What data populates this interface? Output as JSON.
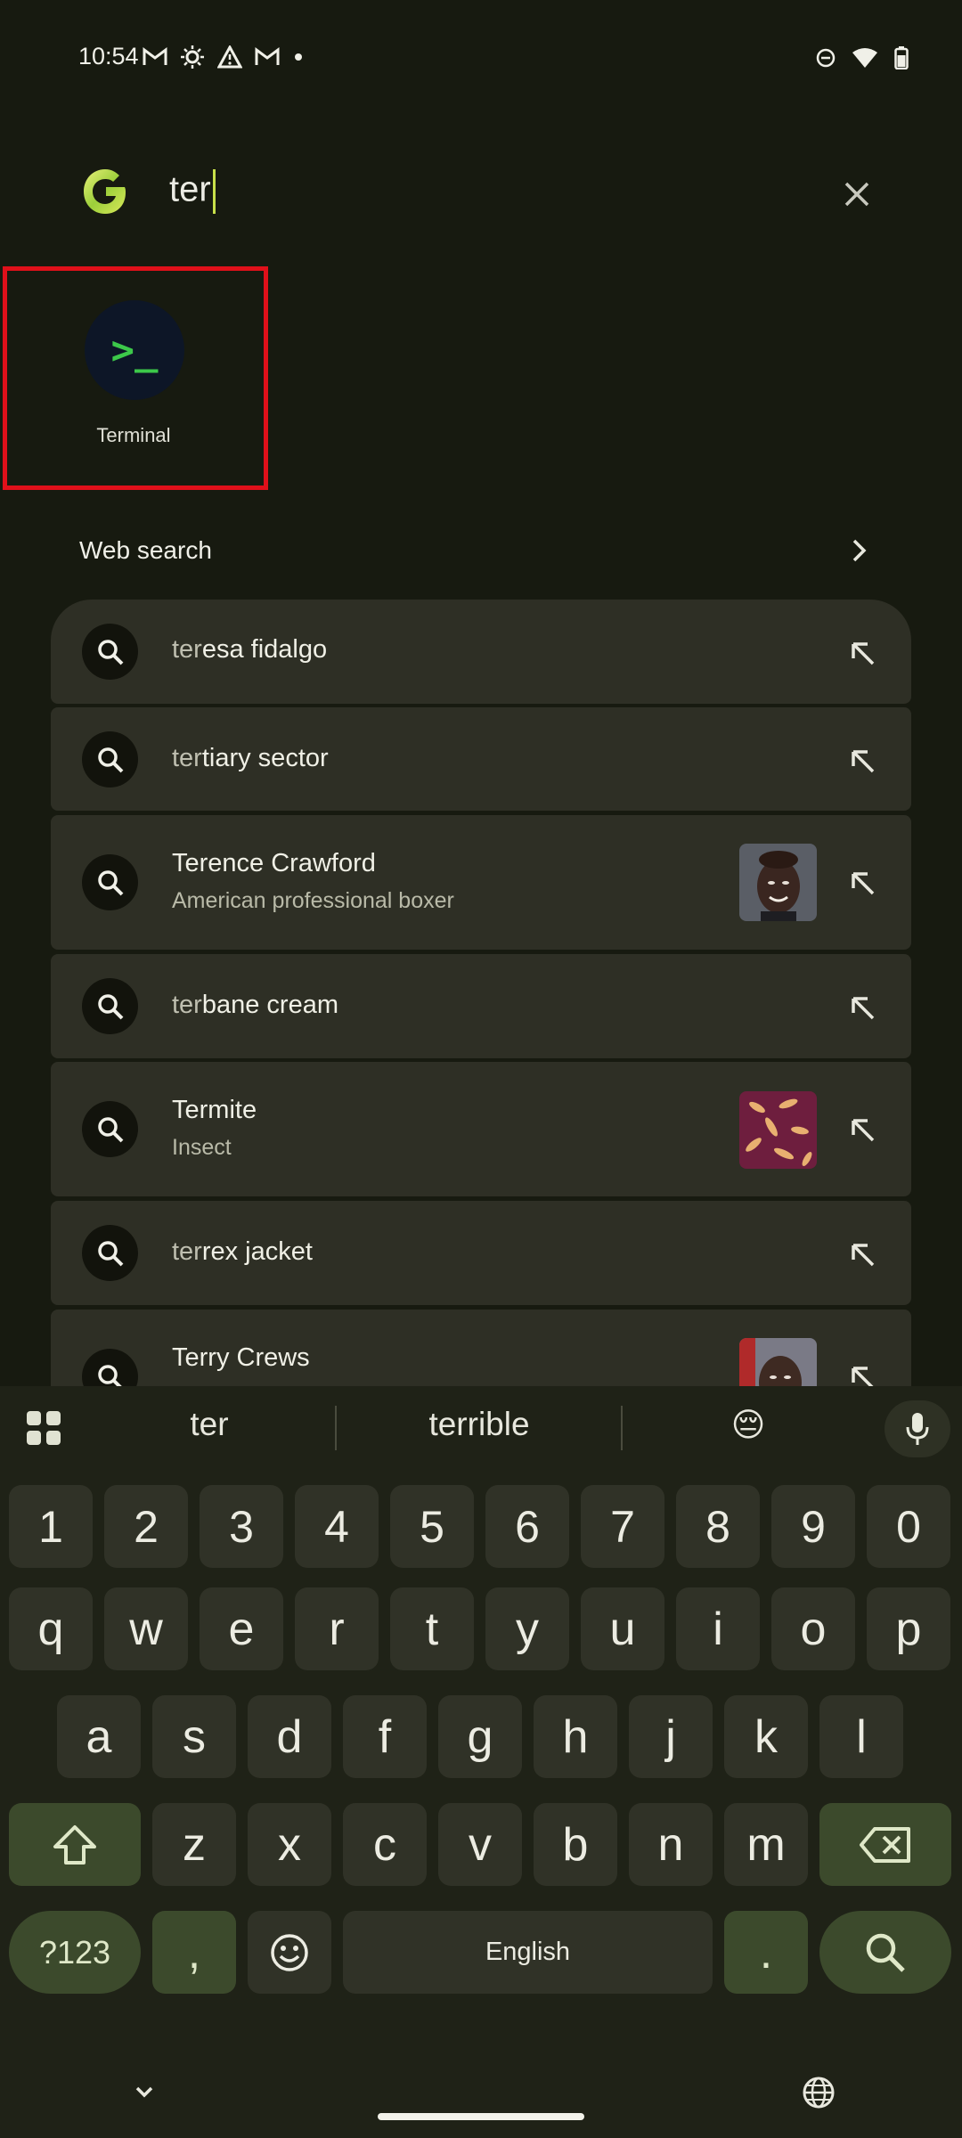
{
  "status_bar": {
    "time": "10:54"
  },
  "search": {
    "query": "ter"
  },
  "app_result": {
    "label": "Terminal",
    "icon_glyph": ">_"
  },
  "web_search": {
    "label": "Web search"
  },
  "suggestions": [
    {
      "typed": "ter",
      "rest": "esa fidalgo",
      "subtitle": ""
    },
    {
      "typed": "ter",
      "rest": "tiary sector",
      "subtitle": ""
    },
    {
      "typed": "",
      "rest": "Terence Crawford",
      "subtitle": "American professional boxer"
    },
    {
      "typed": "ter",
      "rest": "bane cream",
      "subtitle": ""
    },
    {
      "typed": "",
      "rest": "Termite",
      "subtitle": "Insect"
    },
    {
      "typed": "ter",
      "rest": "rex jacket",
      "subtitle": ""
    },
    {
      "typed": "",
      "rest": "Terry Crews",
      "subtitle": ""
    }
  ],
  "keyboard": {
    "suggestions": [
      "ter",
      "terrible",
      "😔"
    ],
    "row_numbers": [
      "1",
      "2",
      "3",
      "4",
      "5",
      "6",
      "7",
      "8",
      "9",
      "0"
    ],
    "row_top": [
      "q",
      "w",
      "e",
      "r",
      "t",
      "y",
      "u",
      "i",
      "o",
      "p"
    ],
    "row_middle": [
      "a",
      "s",
      "d",
      "f",
      "g",
      "h",
      "j",
      "k",
      "l"
    ],
    "row_bottom": [
      "z",
      "x",
      "c",
      "v",
      "b",
      "n",
      "m"
    ],
    "symbols_label": "?123",
    "comma": ",",
    "space_label": "English",
    "period": "."
  },
  "colors": {
    "background": "#171a10",
    "suggestion_card": "#2e2f25",
    "highlight_border": "#e0101a",
    "function_key": "#3c4a2c"
  }
}
